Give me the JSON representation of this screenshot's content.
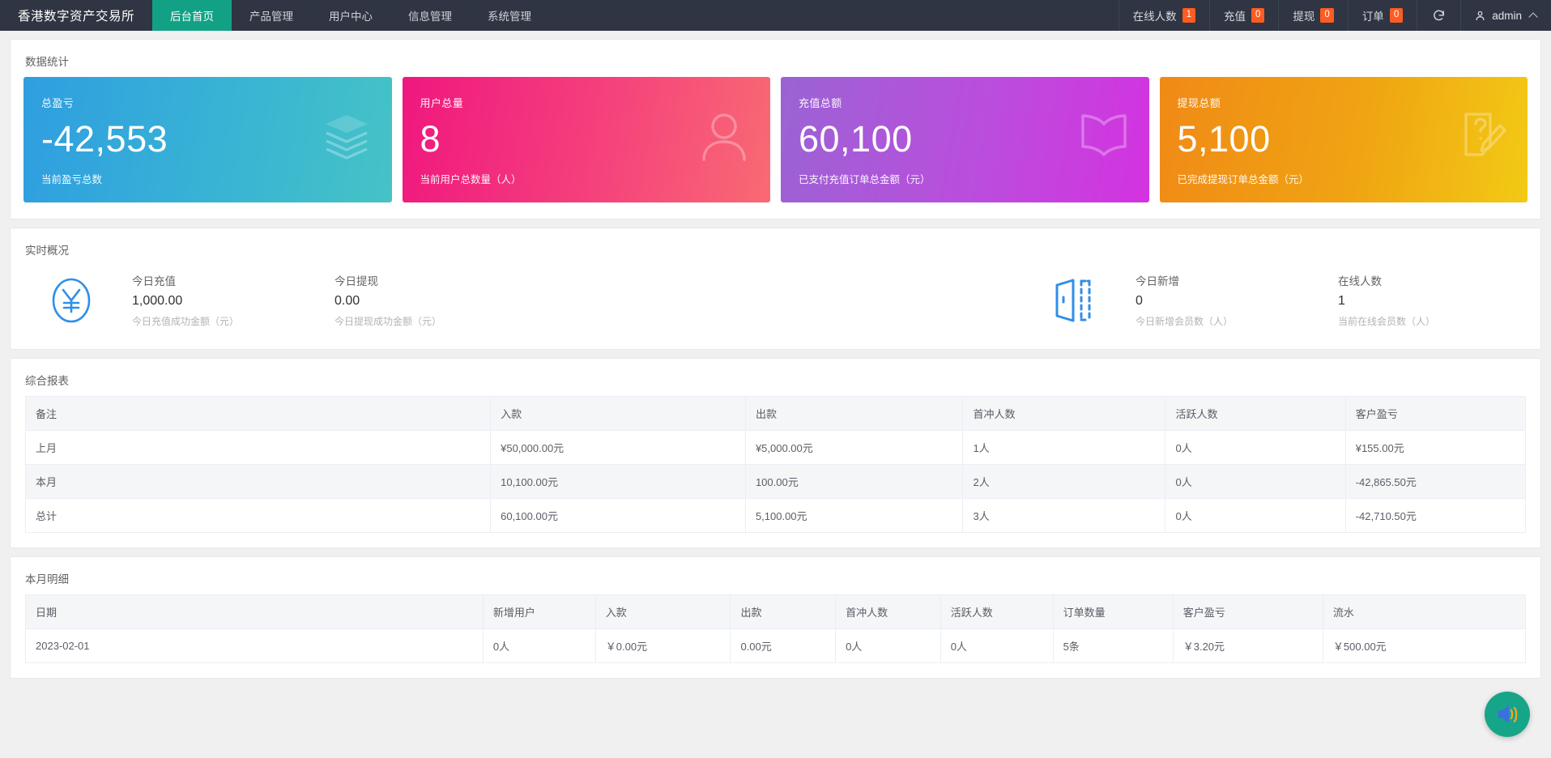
{
  "header": {
    "brand": "香港数字资产交易所",
    "nav": [
      {
        "label": "后台首页",
        "active": true
      },
      {
        "label": "产品管理",
        "active": false
      },
      {
        "label": "用户中心",
        "active": false
      },
      {
        "label": "信息管理",
        "active": false
      },
      {
        "label": "系统管理",
        "active": false
      }
    ],
    "counters": [
      {
        "label": "在线人数",
        "value": "1"
      },
      {
        "label": "充值",
        "value": "0"
      },
      {
        "label": "提现",
        "value": "0"
      },
      {
        "label": "订单",
        "value": "0"
      }
    ],
    "refresh_icon": "refresh-icon",
    "user": "admin",
    "badge_color": "#ff5c22",
    "active_nav_color": "#13a185"
  },
  "stats_panel": {
    "title": "数据统计",
    "cards": [
      {
        "title": "总盈亏",
        "value": "-42,553",
        "desc": "当前盈亏总数",
        "icon": "layers-icon",
        "color": "#2f9ee0"
      },
      {
        "title": "用户总量",
        "value": "8",
        "desc": "当前用户总数量（人）",
        "icon": "user-icon",
        "color": "#f0177f"
      },
      {
        "title": "充值总额",
        "value": "60,100",
        "desc": "已支付充值订单总金额（元）",
        "icon": "book-icon",
        "color": "#bb4ddd"
      },
      {
        "title": "提现总额",
        "value": "5,100",
        "desc": "已完成提现订单总金额（元）",
        "icon": "note-pencil-icon",
        "color": "#f0a413"
      }
    ]
  },
  "realtime_panel": {
    "title": "实时概况",
    "left_icon": "yen-circle-icon",
    "right_icon": "door-icon",
    "left_stats": [
      {
        "label": "今日充值",
        "value": "1,000.00",
        "sub": "今日充值成功金额（元）"
      },
      {
        "label": "今日提现",
        "value": "0.00",
        "sub": "今日提现成功金额（元）"
      }
    ],
    "right_stats": [
      {
        "label": "今日新增",
        "value": "0",
        "sub": "今日新增会员数（人）"
      },
      {
        "label": "在线人数",
        "value": "1",
        "sub": "当前在线会员数（人）"
      }
    ]
  },
  "report_panel": {
    "title": "综合报表",
    "columns": [
      "备注",
      "入款",
      "出款",
      "首冲人数",
      "活跃人数",
      "客户盈亏"
    ],
    "rows": [
      [
        "上月",
        "¥50,000.00元",
        "¥5,000.00元",
        "1人",
        "0人",
        "¥155.00元"
      ],
      [
        "本月",
        "10,100.00元",
        "100.00元",
        "2人",
        "0人",
        "-42,865.50元"
      ],
      [
        "总计",
        "60,100.00元",
        "5,100.00元",
        "3人",
        "0人",
        "-42,710.50元"
      ]
    ]
  },
  "detail_panel": {
    "title": "本月明细",
    "columns": [
      "日期",
      "新增用户",
      "入款",
      "出款",
      "首冲人数",
      "活跃人数",
      "订单数量",
      "客户盈亏",
      "流水"
    ],
    "rows": [
      [
        "2023-02-01",
        "0人",
        "￥0.00元",
        "0.00元",
        "0人",
        "0人",
        "5条",
        "￥3.20元",
        "￥500.00元"
      ]
    ]
  },
  "fab": {
    "icon": "speaker-volume-icon",
    "color": "#17a589"
  }
}
